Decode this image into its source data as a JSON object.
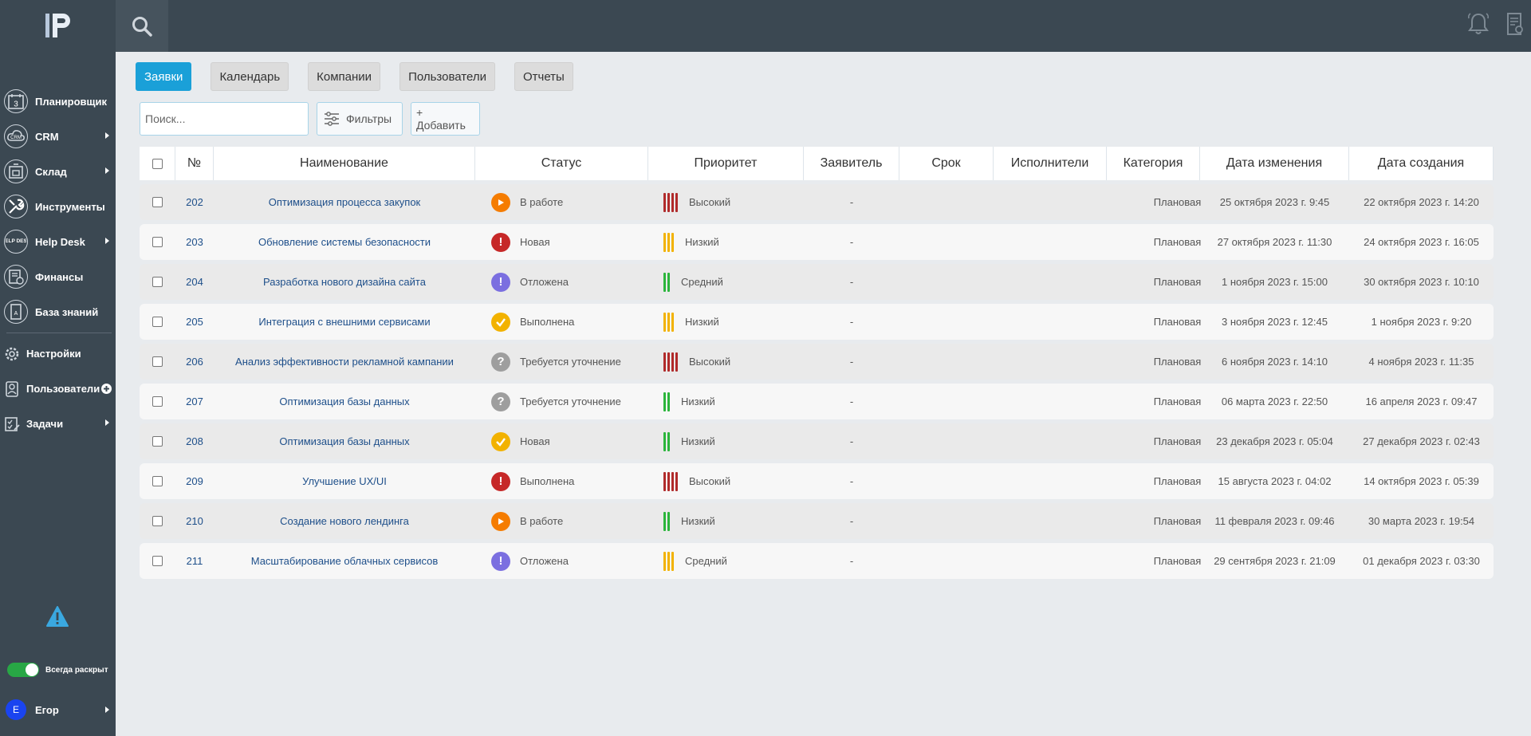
{
  "sidebar": {
    "items": [
      {
        "label": "Планировщик",
        "icon": "calendar-icon",
        "has_arrow": false
      },
      {
        "label": "CRM",
        "icon": "crm-cloud-icon",
        "has_arrow": true
      },
      {
        "label": "Склад",
        "icon": "warehouse-icon",
        "has_arrow": true
      },
      {
        "label": "Инструменты",
        "icon": "tools-icon",
        "has_arrow": false
      },
      {
        "label": "Help Desk",
        "icon": "help-desk-icon",
        "has_arrow": true
      },
      {
        "label": "Финансы",
        "icon": "finance-icon",
        "has_arrow": false
      },
      {
        "label": "База знаний",
        "icon": "knowledge-base-icon",
        "has_arrow": false
      }
    ],
    "secondary": [
      {
        "label": "Настройки",
        "icon": "gear-icon",
        "has_arrow": false
      },
      {
        "label": "Пользователи",
        "icon": "user-icon",
        "has_arrow": false,
        "plus": true
      },
      {
        "label": "Задачи",
        "icon": "tasks-icon",
        "has_arrow": true
      }
    ],
    "calendar_day": "3",
    "crm_icon_text": "CRM",
    "help_icon_text": "HELP DESK",
    "kb_icon_text": "A",
    "toggle_label": "Всегда раскрыт",
    "toggle_on": true,
    "user": {
      "initial": "E",
      "name": "Егор"
    }
  },
  "topbar": {
    "icons": [
      "search-icon",
      "bell-icon",
      "document-settings-icon"
    ]
  },
  "tabs": [
    {
      "label": "Заявки",
      "active": true
    },
    {
      "label": "Календарь",
      "active": false
    },
    {
      "label": "Компании",
      "active": false
    },
    {
      "label": "Пользователи",
      "active": false
    },
    {
      "label": "Отчеты",
      "active": false
    }
  ],
  "toolbar": {
    "search_placeholder": "Поиск...",
    "filters_label": "Фильтры",
    "add_label": "+ Добавить"
  },
  "table": {
    "headers": [
      "№",
      "Наименование",
      "Статус",
      "Приоритет",
      "Заявитель",
      "Срок",
      "Исполнители",
      "Категория",
      "Дата изменения",
      "Дата создания"
    ],
    "rows": [
      {
        "num": "202",
        "title": "Оптимизация процесса закупок",
        "status": "В работе",
        "status_kind": "progress",
        "priority": "Высокий",
        "priority_kind": "high",
        "applicant": "-",
        "category": "Плановая",
        "modified": "25 октября 2023 г. 9:45",
        "created": "22 октября 2023 г. 14:20"
      },
      {
        "num": "203",
        "title": "Обновление системы безопасности",
        "status": "Новая",
        "status_kind": "new",
        "priority": "Низкий",
        "priority_kind": "low-yellow",
        "applicant": "-",
        "category": "Плановая",
        "modified": "27 октября 2023 г. 11:30",
        "created": "24 октября 2023 г. 16:05"
      },
      {
        "num": "204",
        "title": "Разработка нового дизайна сайта",
        "status": "Отложена",
        "status_kind": "postponed",
        "priority": "Средний",
        "priority_kind": "medium-green",
        "applicant": "-",
        "category": "Плановая",
        "modified": "1 ноября 2023 г. 15:00",
        "created": "30 октября 2023 г. 10:10"
      },
      {
        "num": "205",
        "title": "Интеграция с внешними сервисами",
        "status": "Выполнена",
        "status_kind": "done",
        "priority": "Низкий",
        "priority_kind": "low-yellow",
        "applicant": "-",
        "category": "Плановая",
        "modified": "3 ноября 2023 г. 12:45",
        "created": "1 ноября 2023 г. 9:20"
      },
      {
        "num": "206",
        "title": "Анализ эффективности рекламной кампании",
        "status": "Требуется уточнение",
        "status_kind": "clarify",
        "priority": "Высокий",
        "priority_kind": "high",
        "applicant": "-",
        "category": "Плановая",
        "modified": "6 ноября 2023 г. 14:10",
        "created": "4 ноября 2023 г. 11:35"
      },
      {
        "num": "207",
        "title": "Оптимизация базы данных",
        "status": "Требуется уточнение",
        "status_kind": "clarify",
        "priority": "Низкий",
        "priority_kind": "low-green",
        "applicant": "-",
        "category": "Плановая",
        "modified": "06 марта 2023 г. 22:50",
        "created": "16 апреля 2023 г. 09:47"
      },
      {
        "num": "208",
        "title": "Оптимизация базы данных",
        "status": "Новая",
        "status_kind": "done",
        "priority": "Низкий",
        "priority_kind": "low-green",
        "applicant": "-",
        "category": "Плановая",
        "modified": "23 декабря 2023 г. 05:04",
        "created": "27 декабря 2023 г. 02:43"
      },
      {
        "num": "209",
        "title": "Улучшение UX/UI",
        "status": "Выполнена",
        "status_kind": "new",
        "priority": "Высокий",
        "priority_kind": "high",
        "applicant": "-",
        "category": "Плановая",
        "modified": "15 августа 2023 г. 04:02",
        "created": "14 октября 2023 г. 05:39"
      },
      {
        "num": "210",
        "title": "Создание нового лендинга",
        "status": "В работе",
        "status_kind": "progress",
        "priority": "Низкий",
        "priority_kind": "low-green",
        "applicant": "-",
        "category": "Плановая",
        "modified": "11 февраля 2023 г. 09:46",
        "created": "30 марта 2023 г. 19:54"
      },
      {
        "num": "211",
        "title": "Масштабирование облачных сервисов",
        "status": "Отложена",
        "status_kind": "postponed",
        "priority": "Средний",
        "priority_kind": "medium-yellow",
        "applicant": "-",
        "category": "Плановая",
        "modified": "29 сентября 2023 г. 21:09",
        "created": "01 декабря 2023 г. 03:30"
      }
    ]
  },
  "colors": {
    "sidebar_bg": "#3b4852",
    "accent": "#1aa0d8",
    "status": {
      "progress": "#f57c00",
      "new": "#c62828",
      "postponed": "#7b6fe0",
      "done": "#f2b200",
      "clarify": "#9e9e9e"
    },
    "priority": {
      "high": "#b02a2a",
      "yellow": "#f2b200",
      "green": "#2bb53b"
    }
  }
}
